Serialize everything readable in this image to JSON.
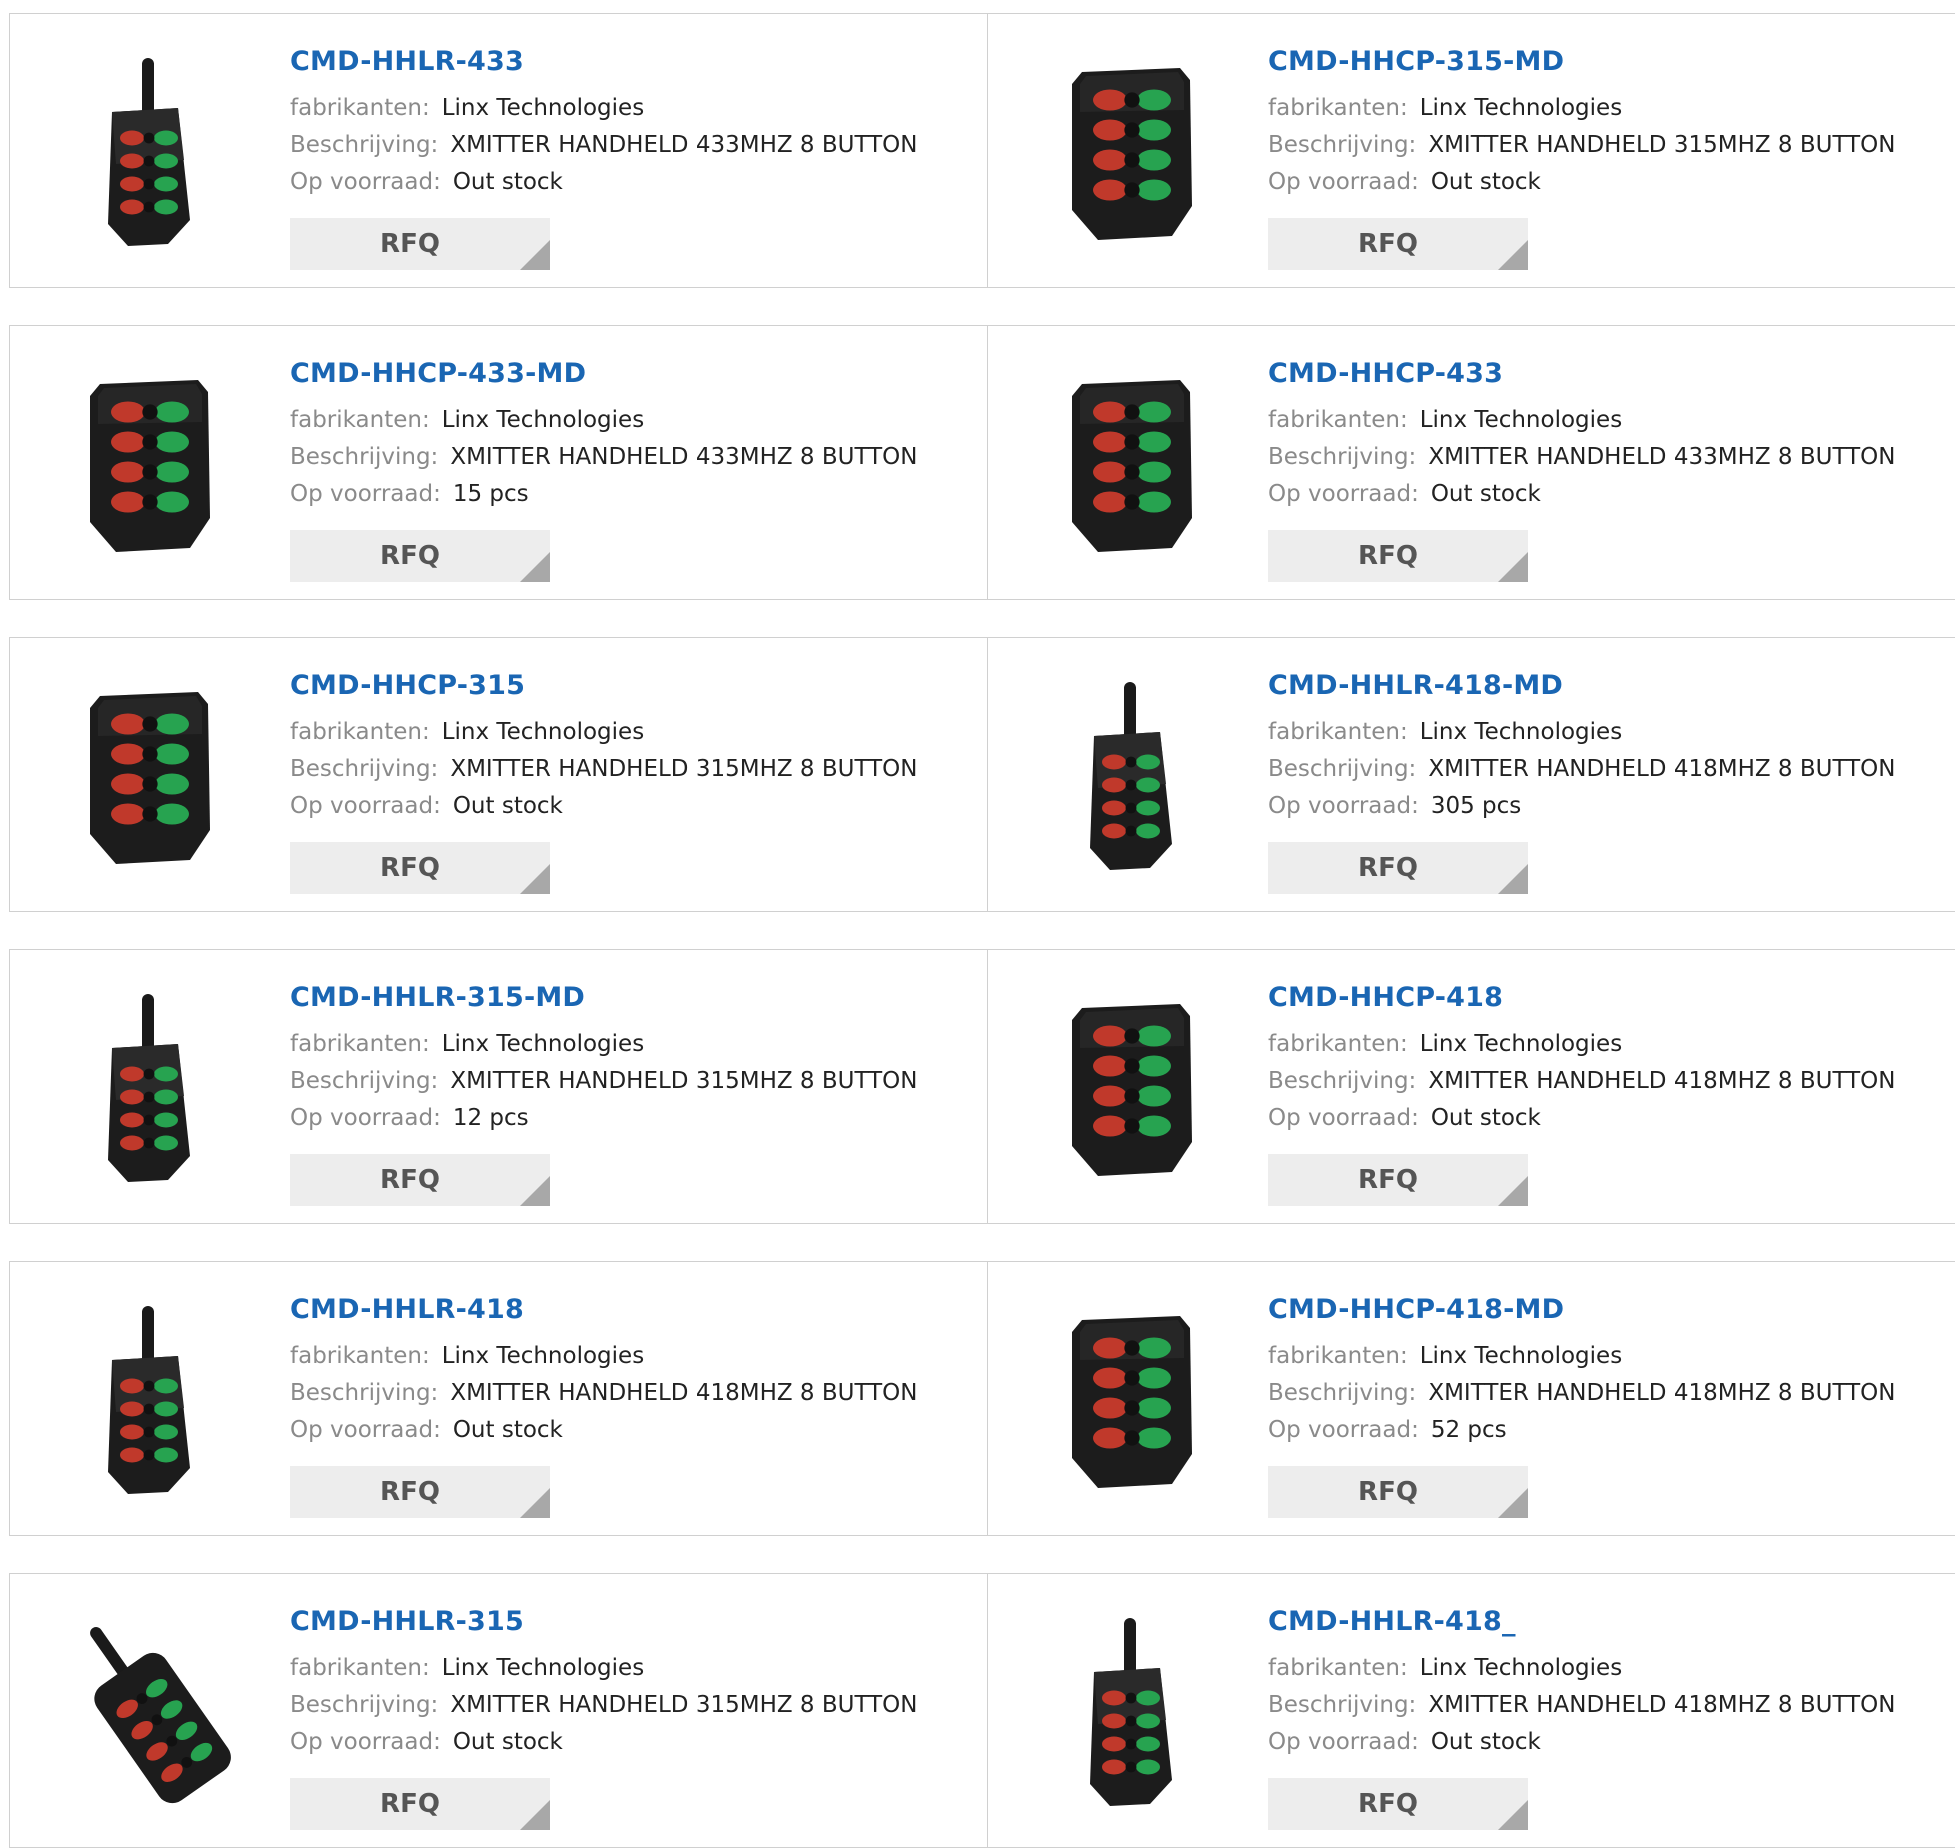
{
  "labels": {
    "manufacturer": "fabrikanten:",
    "description": "Beschrijving:",
    "stock": "Op voorraad:",
    "rfq": "RFQ"
  },
  "colors": {
    "title": "#1a66b3",
    "label": "#8a8a8a",
    "button_bg": "#ededed"
  },
  "products": [
    {
      "part": "CMD-HHLR-433",
      "manufacturer": "Linx Technologies",
      "description": "XMITTER HANDHELD 433MHZ 8 BUTTON",
      "stock": "Out stock",
      "icon": "handheld-remote-antenna-icon"
    },
    {
      "part": "CMD-HHCP-315-MD",
      "manufacturer": "Linx Technologies",
      "description": "XMITTER HANDHELD 315MHZ 8 BUTTON",
      "stock": "Out stock",
      "icon": "handheld-remote-icon"
    },
    {
      "part": "CMD-HHCP-433-MD",
      "manufacturer": "Linx Technologies",
      "description": "XMITTER HANDHELD 433MHZ 8 BUTTON",
      "stock": "15 pcs",
      "icon": "handheld-remote-icon"
    },
    {
      "part": "CMD-HHCP-433",
      "manufacturer": "Linx Technologies",
      "description": "XMITTER HANDHELD 433MHZ 8 BUTTON",
      "stock": "Out stock",
      "icon": "handheld-remote-icon"
    },
    {
      "part": "CMD-HHCP-315",
      "manufacturer": "Linx Technologies",
      "description": "XMITTER HANDHELD 315MHZ 8 BUTTON",
      "stock": "Out stock",
      "icon": "handheld-remote-icon"
    },
    {
      "part": "CMD-HHLR-418-MD",
      "manufacturer": "Linx Technologies",
      "description": "XMITTER HANDHELD 418MHZ 8 BUTTON",
      "stock": "305 pcs",
      "icon": "handheld-remote-antenna-icon"
    },
    {
      "part": "CMD-HHLR-315-MD",
      "manufacturer": "Linx Technologies",
      "description": "XMITTER HANDHELD 315MHZ 8 BUTTON",
      "stock": "12 pcs",
      "icon": "handheld-remote-antenna-icon"
    },
    {
      "part": "CMD-HHCP-418",
      "manufacturer": "Linx Technologies",
      "description": "XMITTER HANDHELD 418MHZ 8 BUTTON",
      "stock": "Out stock",
      "icon": "handheld-remote-icon"
    },
    {
      "part": "CMD-HHLR-418",
      "manufacturer": "Linx Technologies",
      "description": "XMITTER HANDHELD 418MHZ 8 BUTTON",
      "stock": "Out stock",
      "icon": "handheld-remote-antenna-icon"
    },
    {
      "part": "CMD-HHCP-418-MD",
      "manufacturer": "Linx Technologies",
      "description": "XMITTER HANDHELD 418MHZ 8 BUTTON",
      "stock": "52 pcs",
      "icon": "handheld-remote-icon"
    },
    {
      "part": "CMD-HHLR-315",
      "manufacturer": "Linx Technologies",
      "description": "XMITTER HANDHELD 315MHZ 8 BUTTON",
      "stock": "Out stock",
      "icon": "handheld-remote-tilted-icon"
    },
    {
      "part": "CMD-HHLR-418_",
      "manufacturer": "Linx Technologies",
      "description": "XMITTER HANDHELD 418MHZ 8 BUTTON",
      "stock": "Out stock",
      "icon": "handheld-remote-antenna-icon"
    }
  ]
}
